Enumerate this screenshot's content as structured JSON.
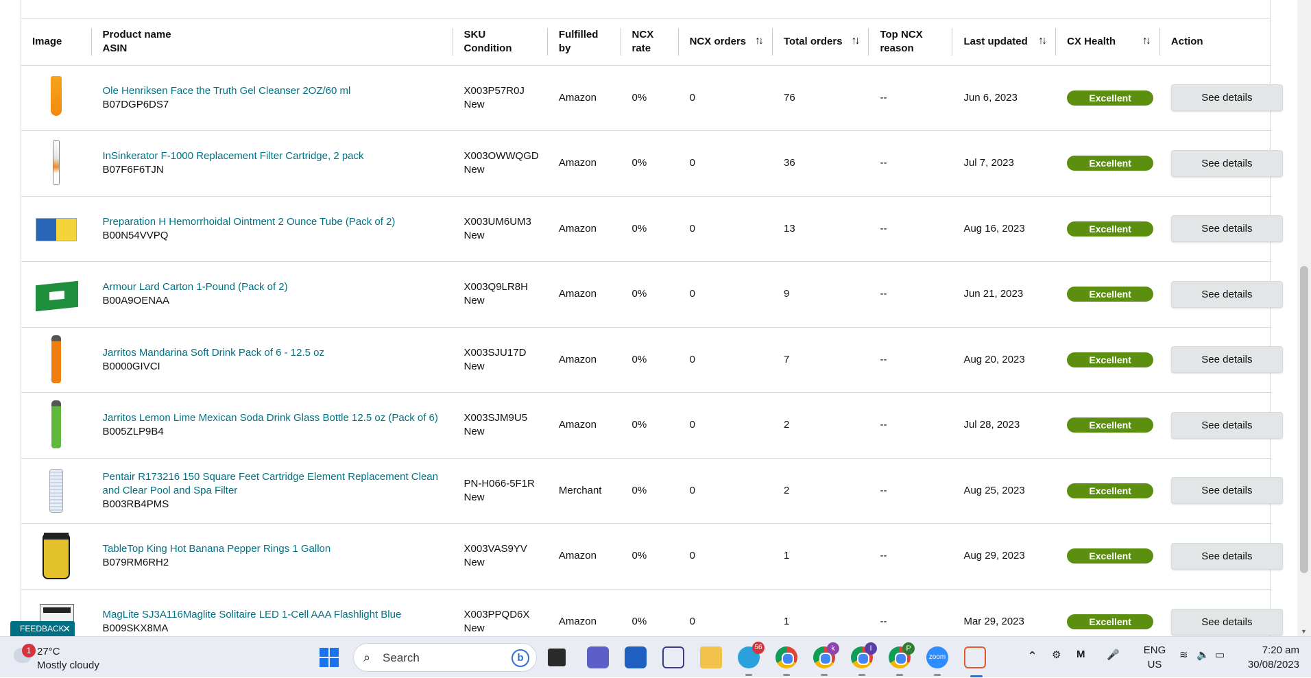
{
  "table": {
    "headers": {
      "image": "Image",
      "product_name": "Product name",
      "asin": "ASIN",
      "sku": "SKU",
      "condition": "Condition",
      "fulfilled_by": "Fulfilled by",
      "ncx_rate": "NCX rate",
      "ncx_orders": "NCX orders",
      "total_orders": "Total orders",
      "top_ncx_reason_1": "Top NCX",
      "top_ncx_reason_2": "reason",
      "last_updated": "Last updated",
      "cx_health": "CX Health",
      "action": "Action"
    },
    "sort_icon": "↑↓",
    "rows": [
      {
        "name": "Ole Henriksen Face the Truth Gel Cleanser 2OZ/60 ml",
        "asin": "B07DGP6DS7",
        "sku": "X003P57R0J",
        "condition": "New",
        "fulfilled": "Amazon",
        "ncx_rate": "0%",
        "ncx_orders": "0",
        "total_orders": "76",
        "reason": "--",
        "updated": "Jun 6, 2023",
        "health": "Excellent",
        "action": "See details"
      },
      {
        "name": "InSinkerator F-1000 Replacement Filter Cartridge, 2 pack",
        "asin": "B07F6F6TJN",
        "sku": "X003OWWQGD",
        "condition": "New",
        "fulfilled": "Amazon",
        "ncx_rate": "0%",
        "ncx_orders": "0",
        "total_orders": "36",
        "reason": "--",
        "updated": "Jul 7, 2023",
        "health": "Excellent",
        "action": "See details"
      },
      {
        "name": "Preparation H Hemorrhoidal Ointment 2 Ounce Tube (Pack of 2)",
        "asin": "B00N54VVPQ",
        "sku": "X003UM6UM3",
        "condition": "New",
        "fulfilled": "Amazon",
        "ncx_rate": "0%",
        "ncx_orders": "0",
        "total_orders": "13",
        "reason": "--",
        "updated": "Aug 16, 2023",
        "health": "Excellent",
        "action": "See details"
      },
      {
        "name": "Armour Lard Carton 1-Pound (Pack of 2)",
        "asin": "B00A9OENAA",
        "sku": "X003Q9LR8H",
        "condition": "New",
        "fulfilled": "Amazon",
        "ncx_rate": "0%",
        "ncx_orders": "0",
        "total_orders": "9",
        "reason": "--",
        "updated": "Jun 21, 2023",
        "health": "Excellent",
        "action": "See details"
      },
      {
        "name": "Jarritos Mandarina Soft Drink Pack of 6 - 12.5 oz",
        "asin": "B0000GIVCI",
        "sku": "X003SJU17D",
        "condition": "New",
        "fulfilled": "Amazon",
        "ncx_rate": "0%",
        "ncx_orders": "0",
        "total_orders": "7",
        "reason": "--",
        "updated": "Aug 20, 2023",
        "health": "Excellent",
        "action": "See details"
      },
      {
        "name": "Jarritos Lemon Lime Mexican Soda Drink Glass Bottle 12.5 oz (Pack of 6)",
        "asin": "B005ZLP9B4",
        "sku": "X003SJM9U5",
        "condition": "New",
        "fulfilled": "Amazon",
        "ncx_rate": "0%",
        "ncx_orders": "0",
        "total_orders": "2",
        "reason": "--",
        "updated": "Jul 28, 2023",
        "health": "Excellent",
        "action": "See details"
      },
      {
        "name": "Pentair R173216 150 Square Feet Cartridge Element Replacement Clean and Clear Pool and Spa Filter",
        "asin": "B003RB4PMS",
        "sku": "PN-H066-5F1R",
        "condition": "New",
        "fulfilled": "Merchant",
        "ncx_rate": "0%",
        "ncx_orders": "0",
        "total_orders": "2",
        "reason": "--",
        "updated": "Aug 25, 2023",
        "health": "Excellent",
        "action": "See details"
      },
      {
        "name": "TableTop King Hot Banana Pepper Rings 1 Gallon",
        "asin": "B079RM6RH2",
        "sku": "X003VAS9YV",
        "condition": "New",
        "fulfilled": "Amazon",
        "ncx_rate": "0%",
        "ncx_orders": "0",
        "total_orders": "1",
        "reason": "--",
        "updated": "Aug 29, 2023",
        "health": "Excellent",
        "action": "See details"
      },
      {
        "name": "MagLite SJ3A116Maglite Solitaire LED 1-Cell AAA Flashlight Blue",
        "asin": "B009SKX8MA",
        "sku": "X003PPQD6X",
        "condition": "New",
        "fulfilled": "Amazon",
        "ncx_rate": "0%",
        "ncx_orders": "0",
        "total_orders": "1",
        "reason": "--",
        "updated": "Mar 29, 2023",
        "health": "Excellent",
        "action": "See details"
      }
    ]
  },
  "colors": {
    "link": "#007185",
    "badge": "#5c8f0f",
    "button": "#e3e6e6"
  },
  "feedback": {
    "label": "FEEDBACK",
    "close": "✕"
  },
  "taskbar": {
    "weather_badge": "1",
    "temperature": "27°C",
    "condition": "Mostly cloudy",
    "search_label": "Search",
    "telegram_count": "56",
    "lang_1": "ENG",
    "lang_2": "US",
    "time": "7:20 am",
    "date": "30/08/2023",
    "profile_letters": [
      "k",
      "I",
      "P"
    ],
    "zoom_label": "zoom"
  }
}
